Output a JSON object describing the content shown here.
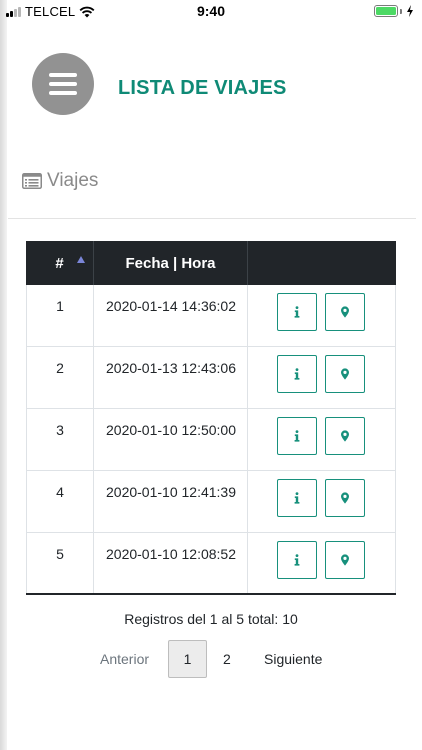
{
  "status_bar": {
    "carrier": "TELCEL",
    "time": "9:40",
    "battery_color": "#4cd964"
  },
  "header": {
    "menu_icon": "hamburger-menu-icon",
    "title": "LISTA DE VIAJES",
    "title_color": "#0f8a76"
  },
  "section": {
    "icon": "list-icon",
    "label": "Viajes"
  },
  "table": {
    "columns": [
      "#",
      "Fecha | Hora",
      ""
    ],
    "rows": [
      {
        "num": "1",
        "datetime": "2020-01-14 14:36:02"
      },
      {
        "num": "2",
        "datetime": "2020-01-13 12:43:06"
      },
      {
        "num": "3",
        "datetime": "2020-01-10 12:50:00"
      },
      {
        "num": "4",
        "datetime": "2020-01-10 12:41:39"
      },
      {
        "num": "5",
        "datetime": "2020-01-10 12:08:52"
      }
    ],
    "row_actions": [
      "info-icon",
      "map-marker-icon"
    ],
    "accent_color": "#17907c"
  },
  "footer": {
    "records_text": "Registros del 1 al 5 total: 10",
    "pagination": {
      "prev": "Anterior",
      "pages": [
        "1",
        "2"
      ],
      "current": "1",
      "next": "Siguiente"
    }
  }
}
